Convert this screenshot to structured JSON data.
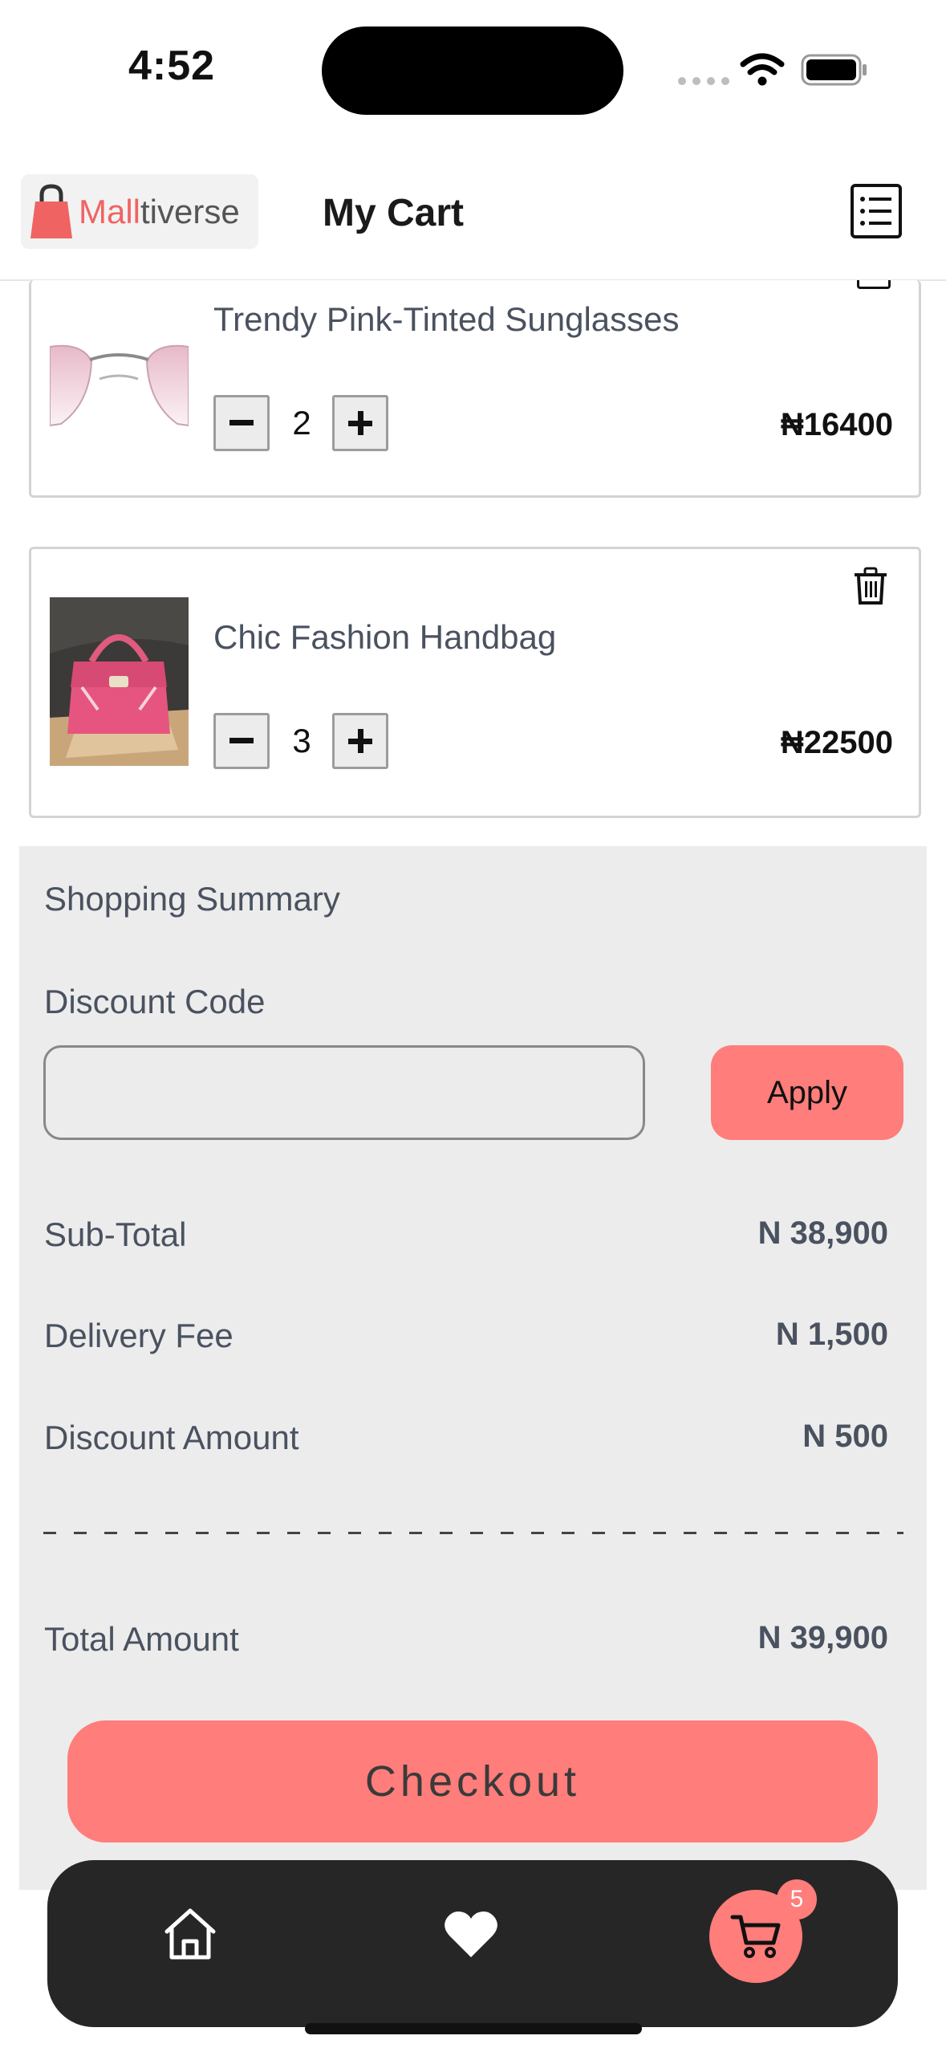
{
  "status_bar": {
    "time": "4:52"
  },
  "header": {
    "logo_part1": "Mall",
    "logo_part2": "tiverse",
    "title": "My Cart"
  },
  "cart_items": [
    {
      "name": "Trendy Pink-Tinted Sunglasses",
      "quantity": "2",
      "price": "₦16400"
    },
    {
      "name": "Chic Fashion Handbag",
      "quantity": "3",
      "price": "₦22500"
    }
  ],
  "summary": {
    "title": "Shopping Summary",
    "discount_label": "Discount Code",
    "discount_value": "",
    "apply_label": "Apply",
    "subtotal_label": "Sub-Total",
    "subtotal_value": "N 38,900",
    "delivery_label": "Delivery Fee",
    "delivery_value": "N 1,500",
    "discount_amount_label": "Discount Amount",
    "discount_amount_value": "N 500",
    "total_label": "Total Amount",
    "total_value": "N 39,900",
    "checkout_label": "Checkout"
  },
  "bottom_nav": {
    "items": [
      "home-icon",
      "heart-icon",
      "cart-icon"
    ],
    "cart_badge": "5"
  },
  "colors": {
    "accent": "#ff7d7a",
    "nav_bg": "#262626",
    "summary_bg": "#ececec"
  }
}
